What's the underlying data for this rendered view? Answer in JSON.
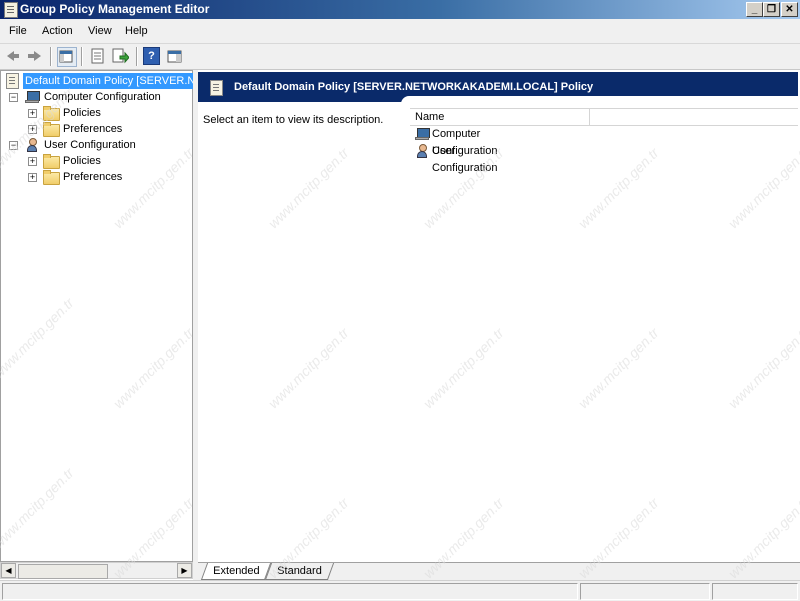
{
  "window": {
    "title": "Group Policy Management Editor",
    "minimize_glyph": "_",
    "maximize_glyph": "❐",
    "close_glyph": "✕"
  },
  "menu": [
    "File",
    "Action",
    "View",
    "Help"
  ],
  "toolbar": {
    "icons": [
      "back-arrow-icon",
      "forward-arrow-icon",
      "show-hide-console-tree-icon",
      "properties-icon",
      "export-list-icon",
      "help-icon",
      "show-hide-action-pane-icon"
    ],
    "help_glyph": "?"
  },
  "tree": {
    "root": "Default Domain Policy [SERVER.NET",
    "computer_config": "Computer Configuration",
    "computer_policies": "Policies",
    "computer_preferences": "Preferences",
    "user_config": "User Configuration",
    "user_policies": "Policies",
    "user_preferences": "Preferences",
    "expanded_glyph": "−",
    "collapsed_glyph": "+"
  },
  "details": {
    "header": "Default Domain Policy [SERVER.NETWORKAKADEMI.LOCAL] Policy",
    "description": "Select an item to view its description.",
    "column_name": "Name",
    "items": [
      "Computer Configuration",
      "User Configuration"
    ]
  },
  "tabs": {
    "extended": "Extended",
    "standard": "Standard"
  },
  "scrollbar": {
    "left_glyph": "◀",
    "right_glyph": "▶"
  },
  "watermark": "www.mcitp.gen.tr",
  "colors": {
    "title_bar": "#0a246a",
    "selection": "#3399ff",
    "header_band": "#0a2a6a"
  }
}
